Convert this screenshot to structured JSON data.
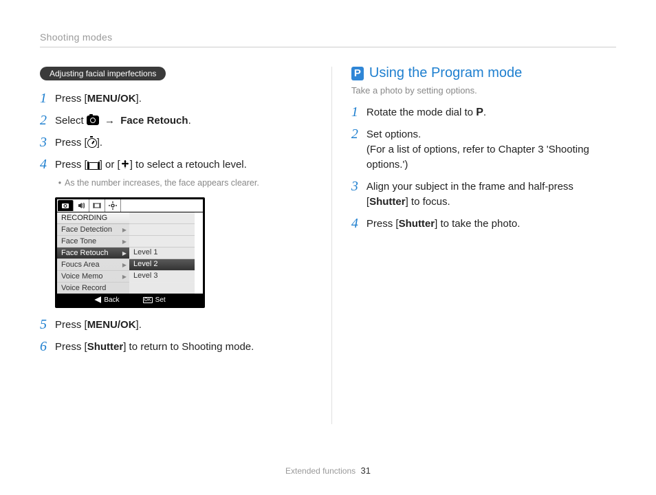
{
  "header": {
    "breadcrumb": "Shooting modes"
  },
  "left": {
    "pill": "Adjusting facial imperfections",
    "s1_a": "Press [",
    "s1_b": "MENU/OK",
    "s1_c": "].",
    "s2_a": "Select ",
    "s2_arrow": "→",
    "s2_b": "Face Retouch",
    "s2_c": ".",
    "s3_a": "Press [",
    "s3_b": "].",
    "s4_a": "Press [",
    "s4_b": "] or [",
    "s4_c": "] to select a retouch level.",
    "s4_note": "As the number increases, the face appears clearer.",
    "s5_a": "Press [",
    "s5_b": "MENU/OK",
    "s5_c": "].",
    "s6_a": "Press [",
    "s6_b": "Shutter",
    "s6_c": "] to return to Shooting mode."
  },
  "menu": {
    "section": "RECORDING",
    "rows": [
      "Face Detection",
      "Face Tone",
      "Face Retouch",
      "Foucs Area",
      "Voice Memo",
      "Voice Record"
    ],
    "levels": [
      "Level 1",
      "Level 2",
      "Level 3"
    ],
    "back": "Back",
    "set": "Set"
  },
  "right": {
    "p_badge": "P",
    "title": "Using the Program mode",
    "subtitle": "Take a photo by setting options.",
    "s1_a": "Rotate the mode dial to ",
    "s1_p": "P",
    "s1_b": ".",
    "s2_a": "Set options.",
    "s2_b": "(For a list of options, refer to Chapter 3 'Shooting options.')",
    "s3_a": "Align your subject in the frame and half-press [",
    "s3_b": "Shutter",
    "s3_c": "] to focus.",
    "s4_a": "Press [",
    "s4_b": "Shutter",
    "s4_c": "] to take the photo."
  },
  "footer": {
    "section": "Extended functions",
    "page": "31"
  }
}
